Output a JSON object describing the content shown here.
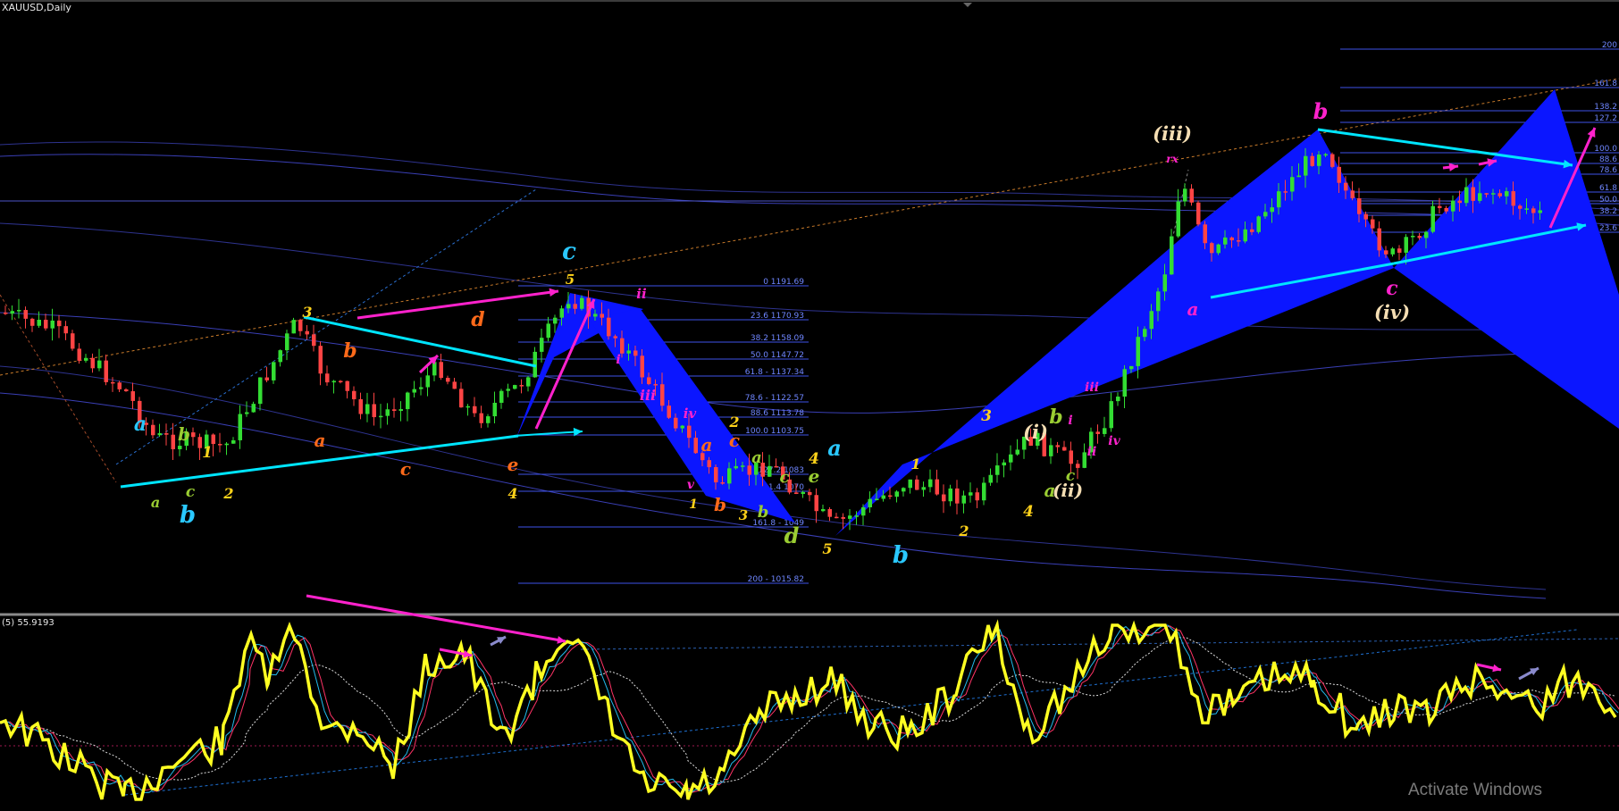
{
  "header": {
    "symbol": "XAUUSD,Daily"
  },
  "oscillator": {
    "label": "(5) 55.9193"
  },
  "overlay": {
    "watermark": "Activate Windows"
  },
  "colors": {
    "background": "#000000",
    "bull": "#33dd33",
    "bear": "#ff4444",
    "trend": "#00e5ff",
    "pattern": "#0b16ff",
    "magenta": "#ff22cc",
    "yellow": "#ffff22",
    "orange": "#ff6a1a"
  },
  "chart_data": {
    "type": "candlestick",
    "title": "XAUUSD,Daily",
    "fib_left": [
      {
        "label": "0 1191.69"
      },
      {
        "label": "23.6 1170.93"
      },
      {
        "label": "38.2 1158.09"
      },
      {
        "label": "50.0 1147.72"
      },
      {
        "label": "61.8 - 1137.34"
      },
      {
        "label": "78.6 - 1122.57"
      },
      {
        "label": "88.6 1113.78"
      },
      {
        "label": "100.0 1103.75"
      },
      {
        "label": "127.2 1083"
      },
      {
        "label": "141.4 1070"
      },
      {
        "label": "161.8 - 1049"
      },
      {
        "label": "200 - 1015.82"
      }
    ],
    "fib_right": [
      "200",
      "161.8",
      "138.2",
      "127.2",
      "100.0",
      "88.6",
      "78.6",
      "61.8",
      "50.0",
      "38.2",
      "23.6"
    ],
    "wave_labels": [
      {
        "t": "a",
        "c": "#2ac8ff"
      },
      {
        "t": "b",
        "c": "#2ac8ff"
      },
      {
        "t": "a",
        "c": "#9acd32"
      },
      {
        "t": "b",
        "c": "#9acd32"
      },
      {
        "t": "c",
        "c": "#9acd32"
      },
      {
        "t": "1",
        "c": "#ffd21a"
      },
      {
        "t": "2",
        "c": "#ffd21a"
      },
      {
        "t": "3",
        "c": "#ffd21a"
      },
      {
        "t": "b",
        "c": "#ff6a1a"
      },
      {
        "t": "a",
        "c": "#ff6a1a"
      },
      {
        "t": "c",
        "c": "#ff6a1a"
      },
      {
        "t": "d",
        "c": "#ff6a1a"
      },
      {
        "t": "e",
        "c": "#ff6a1a"
      },
      {
        "t": "4",
        "c": "#ffd21a"
      },
      {
        "t": "c",
        "c": "#2ac8ff"
      },
      {
        "t": "5",
        "c": "#ffd21a"
      },
      {
        "t": "ii",
        "c": "#ff22cc"
      },
      {
        "t": "i",
        "c": "#ff22cc"
      },
      {
        "t": "iii",
        "c": "#ff22cc"
      },
      {
        "t": "iv",
        "c": "#ff22cc"
      },
      {
        "t": "v",
        "c": "#ff22cc"
      },
      {
        "t": "2",
        "c": "#ffd21a"
      },
      {
        "t": "a",
        "c": "#ff6a1a"
      },
      {
        "t": "c",
        "c": "#ff6a1a"
      },
      {
        "t": "1",
        "c": "#ffd21a"
      },
      {
        "t": "b",
        "c": "#ff6a1a"
      },
      {
        "t": "3",
        "c": "#ffd21a"
      },
      {
        "t": "a",
        "c": "#9acd32"
      },
      {
        "t": "b",
        "c": "#9acd32"
      },
      {
        "t": "c",
        "c": "#9acd32"
      },
      {
        "t": "d",
        "c": "#9acd32"
      },
      {
        "t": "4",
        "c": "#ffd21a"
      },
      {
        "t": "e",
        "c": "#9acd32"
      },
      {
        "t": "5",
        "c": "#ffd21a"
      },
      {
        "t": "a",
        "c": "#2ac8ff"
      },
      {
        "t": "b",
        "c": "#2ac8ff"
      },
      {
        "t": "1",
        "c": "#ffd21a"
      },
      {
        "t": "2",
        "c": "#ffd21a"
      },
      {
        "t": "3",
        "c": "#ffd21a"
      },
      {
        "t": "4",
        "c": "#ffd21a"
      },
      {
        "t": "(i)",
        "c": "#f5deb3"
      },
      {
        "t": "b",
        "c": "#9acd32"
      },
      {
        "t": "c",
        "c": "#9acd32"
      },
      {
        "t": "a",
        "c": "#9acd32"
      },
      {
        "t": "(ii)",
        "c": "#f5deb3"
      },
      {
        "t": "i",
        "c": "#ff22cc"
      },
      {
        "t": "ii",
        "c": "#ff22cc"
      },
      {
        "t": "iii",
        "c": "#ff22cc"
      },
      {
        "t": "iv",
        "c": "#ff22cc"
      },
      {
        "t": "(iii)",
        "c": "#f5deb3"
      },
      {
        "t": "rx",
        "c": "#ff22cc"
      },
      {
        "t": "a",
        "c": "#ff22cc"
      },
      {
        "t": "b",
        "c": "#ff22cc"
      },
      {
        "t": "c",
        "c": "#ff22cc"
      },
      {
        "t": "(iv)",
        "c": "#f5deb3"
      }
    ]
  }
}
